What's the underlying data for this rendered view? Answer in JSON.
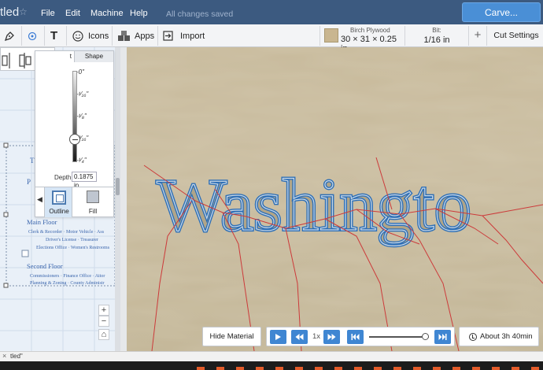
{
  "app": {
    "title_fragment": "tled",
    "menus": [
      "File",
      "Edit",
      "Machine",
      "Help"
    ],
    "save_status": "All changes saved",
    "carve_label": "Carve..."
  },
  "toolbar": {
    "icons_label": "Icons",
    "apps_label": "Apps",
    "import_label": "Import",
    "material_name": "Birch Plywood",
    "material_dims": "30 × 31 × 0.25 in",
    "bit_label": "Bit:",
    "bit_value": "1/16 in",
    "add_label": "+",
    "cut_settings_label": "Cut Settings"
  },
  "depth_panel": {
    "tab_cut": "t",
    "tab_shape": "Shape",
    "ticks": [
      "-0\"",
      "-¹⁄₁₆\"",
      "-¹⁄₈\"",
      "-³⁄₁₆\"",
      "-¹⁄₄\""
    ],
    "depth_label": "Depth",
    "depth_value": "0.1875 in",
    "depth_fraction": 0.75,
    "outline_label": "Outline",
    "fill_label": "Fill"
  },
  "design_text": {
    "heading": "Main Floor",
    "main_line1": "Clerk & Recorder · Motor Vehicle · Ass",
    "main_line2": "Driver's License · Treasurer",
    "main_line3": "Elections Office · Women's Restrooms",
    "second_heading": "Second Floor",
    "second_line1": "Commissioners · Finance Office · Attor",
    "second_line2": "Planning & Zoning · County Administr"
  },
  "preview": {
    "carved_word": "Washingto"
  },
  "zoom": {
    "plus": "+",
    "minus": "−",
    "home": "⌂"
  },
  "playback": {
    "hide_material_label": "Hide Material",
    "speed": "1x",
    "progress": 0.93,
    "estimate": "About 3h 40min"
  },
  "status_strip": {
    "close": "×",
    "tab_title": "tled\""
  },
  "colors": {
    "menubar": "#3c5a80",
    "carve_button": "#4a8fd6",
    "play_buttons": "#3f86d2",
    "toolpath": "#d23030",
    "carved_outline": "#3f76b6"
  }
}
